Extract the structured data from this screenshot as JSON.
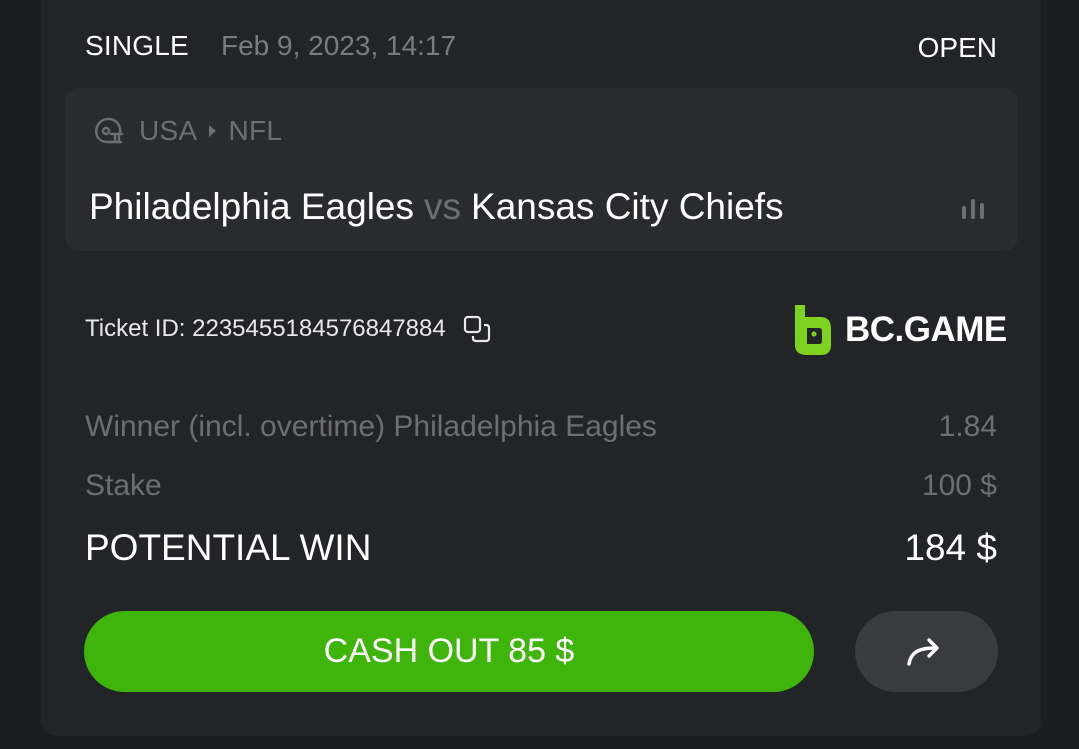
{
  "header": {
    "bet_type": "SINGLE",
    "date": "Feb 9, 2023, 14:17",
    "status": "OPEN"
  },
  "event": {
    "sport_icon": "football-helmet-icon",
    "country": "USA",
    "league": "NFL",
    "home_team": "Philadelphia Eagles",
    "vs": "vs",
    "away_team": "Kansas City Chiefs",
    "stats_icon": "bar-chart-icon"
  },
  "ticket": {
    "label": "Ticket ID: 223545518457684788​4",
    "copy_icon": "copy-icon"
  },
  "brand": {
    "logo_text": "BC.GAME",
    "accent": "#7ed321"
  },
  "selection": {
    "market": "Winner (incl. overtime) Philadelphia Eagles",
    "odds": "1.84"
  },
  "stake": {
    "label": "Stake",
    "value": "100 $"
  },
  "potential_win": {
    "label": "POTENTIAL WIN",
    "value": "184 $"
  },
  "actions": {
    "cashout_label": "CASH OUT 85 $",
    "cashout_color": "#3fb50c",
    "share_icon": "share-arrow-icon"
  }
}
